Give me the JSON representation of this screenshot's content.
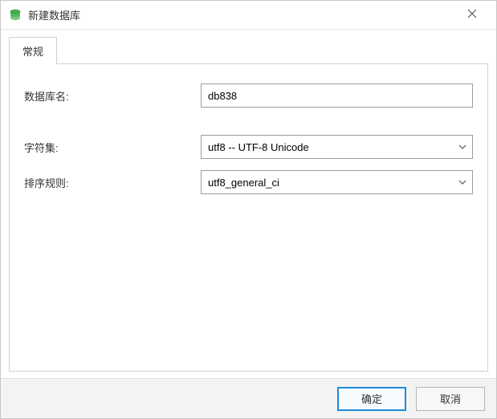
{
  "window": {
    "title": "新建数据库"
  },
  "tabs": {
    "general": "常规"
  },
  "form": {
    "db_name_label": "数据库名:",
    "db_name_value": "db838",
    "charset_label": "字符集:",
    "charset_value": "utf8 -- UTF-8 Unicode",
    "collation_label": "排序规则:",
    "collation_value": "utf8_general_ci"
  },
  "buttons": {
    "ok": "确定",
    "cancel": "取消"
  }
}
